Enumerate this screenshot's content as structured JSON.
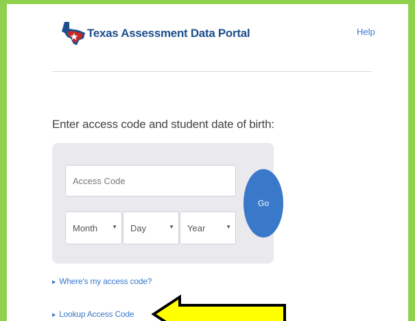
{
  "header": {
    "brand": "Texas Assessment Data Portal",
    "help_label": "Help"
  },
  "form": {
    "prompt": "Enter access code and student date of birth:",
    "access_code_placeholder": "Access Code",
    "month_label": "Month",
    "day_label": "Day",
    "year_label": "Year",
    "go_label": "Go"
  },
  "links": {
    "where_code": "Where's my access code?",
    "lookup_code": "Lookup Access Code"
  },
  "colors": {
    "border_green": "#8fd14f",
    "brand_blue": "#1f4e8c",
    "link_blue": "#3a78c9",
    "arrow_yellow": "#ffff00"
  },
  "icons": {
    "logo": "texas-map-logo-icon",
    "caret": "caret-down-icon",
    "bullet": "triangle-right-icon",
    "annotation": "yellow-arrow-icon"
  }
}
